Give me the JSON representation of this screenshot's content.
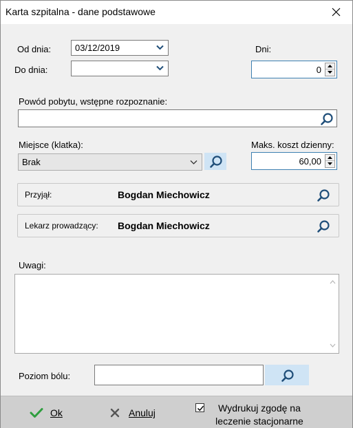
{
  "window": {
    "title": "Karta szpitalna - dane podstawowe"
  },
  "dates": {
    "from_label": "Od dnia:",
    "from_value": "03/12/2019",
    "to_label": "Do dnia:",
    "to_value": ""
  },
  "days": {
    "label": "Dni:",
    "value": "0"
  },
  "reason": {
    "label": "Powód pobytu, wstępne rozpoznanie:",
    "value": ""
  },
  "place": {
    "label": "Miejsce (klatka):",
    "value": "Brak"
  },
  "max_cost": {
    "label": "Maks. koszt dzienny:",
    "value": "60,00"
  },
  "admitted": {
    "label": "Przyjął:",
    "value": "Bogdan Miechowicz"
  },
  "doctor": {
    "label": "Lekarz prowadzący:",
    "value": "Bogdan Miechowicz"
  },
  "notes": {
    "label": "Uwagi:",
    "value": ""
  },
  "pain": {
    "label": "Poziom bólu:",
    "value": ""
  },
  "footer": {
    "ok_label": "Ok",
    "cancel_label": "Anuluj",
    "consent_line1": "Wydrukuj zgodę na",
    "consent_line2": "leczenie stacjonarne",
    "consent_checked": true
  },
  "colors": {
    "accent": "#3c7fb1",
    "search_button": "#cfe4f5",
    "ok_check": "#2e9e3e"
  }
}
